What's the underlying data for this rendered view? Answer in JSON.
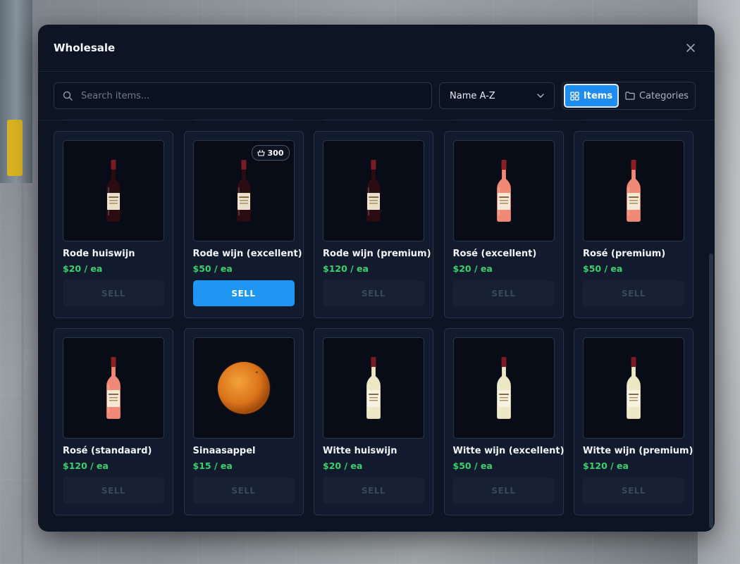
{
  "modal": {
    "title": "Wholesale"
  },
  "toolbar": {
    "search_placeholder": "Search items...",
    "sort_value": "Name A-Z",
    "view_items_label": "Items",
    "view_categories_label": "Categories",
    "active_view": "Items"
  },
  "items": [
    {
      "name": "Rode huiswijn",
      "price": "$20 / ea",
      "sell_label": "SELL",
      "enabled": false,
      "icon": "red-wine-bottle",
      "qty": null
    },
    {
      "name": "Rode wijn (excellent)",
      "price": "$50 / ea",
      "sell_label": "SELL",
      "enabled": true,
      "icon": "red-wine-bottle",
      "qty": "300"
    },
    {
      "name": "Rode wijn (premium)",
      "price": "$120 / ea",
      "sell_label": "SELL",
      "enabled": false,
      "icon": "red-wine-bottle",
      "qty": null
    },
    {
      "name": "Rosé (excellent)",
      "price": "$20 / ea",
      "sell_label": "SELL",
      "enabled": false,
      "icon": "rose-wine-bottle",
      "qty": null
    },
    {
      "name": "Rosé (premium)",
      "price": "$50 / ea",
      "sell_label": "SELL",
      "enabled": false,
      "icon": "rose-wine-bottle",
      "qty": null
    },
    {
      "name": "Rosé (standaard)",
      "price": "$120 / ea",
      "sell_label": "SELL",
      "enabled": false,
      "icon": "rose-wine-bottle",
      "qty": null
    },
    {
      "name": "Sinaasappel",
      "price": "$15 / ea",
      "sell_label": "SELL",
      "enabled": false,
      "icon": "orange-fruit",
      "qty": null
    },
    {
      "name": "Witte huiswijn",
      "price": "$20 / ea",
      "sell_label": "SELL",
      "enabled": false,
      "icon": "white-wine-bottle",
      "qty": null
    },
    {
      "name": "Witte wijn (excellent)",
      "price": "$50 / ea",
      "sell_label": "SELL",
      "enabled": false,
      "icon": "white-wine-bottle",
      "qty": null
    },
    {
      "name": "Witte wijn (premium)",
      "price": "$120 / ea",
      "sell_label": "SELL",
      "enabled": false,
      "icon": "white-wine-bottle",
      "qty": null
    }
  ],
  "colors": {
    "accent": "#1f97f2",
    "price_green": "#3bd16f",
    "modal_bg": "#0d1524",
    "card_bg": "#111b2d"
  }
}
